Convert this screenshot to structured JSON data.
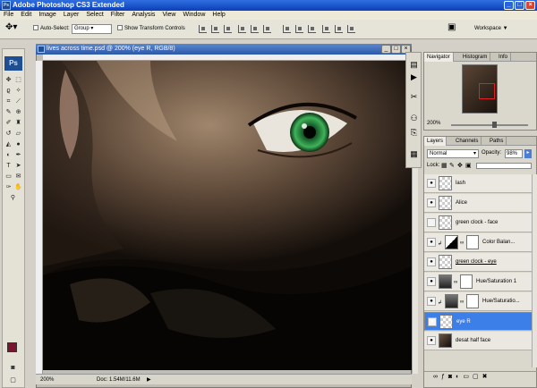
{
  "app": {
    "title": "Adobe Photoshop CS3 Extended"
  },
  "menu": [
    "File",
    "Edit",
    "Image",
    "Layer",
    "Select",
    "Filter",
    "Analysis",
    "View",
    "Window",
    "Help"
  ],
  "options": {
    "auto_select_label": "Auto-Select:",
    "auto_select_value": "Group",
    "show_transform_label": "Show Transform Controls",
    "workspace_label": "Workspace ▼"
  },
  "toolbox": {
    "logo": "Ps"
  },
  "document": {
    "title": "lives across time.psd @ 200% (eye R, RGB/8)",
    "zoom": "200%",
    "doc_size": "Doc: 1.54M/11.6M"
  },
  "navigator": {
    "tabs": [
      "Navigator",
      "Histogram",
      "Info"
    ],
    "zoom": "200%"
  },
  "layers": {
    "tabs": [
      "Layers",
      "Channels",
      "Paths"
    ],
    "blend_mode": "Normal",
    "opacity_label": "Opacity:",
    "opacity_value": "98%",
    "lock_label": "Lock:",
    "items": [
      {
        "name": "lash"
      },
      {
        "name": "Alice"
      },
      {
        "name": "green clock - face"
      },
      {
        "name": "Color Balan..."
      },
      {
        "name": "green clock - eye"
      },
      {
        "name": "Hue/Saturation 1"
      },
      {
        "name": "Hue/Saturatio..."
      },
      {
        "name": "eye R"
      },
      {
        "name": "desat half face"
      }
    ]
  },
  "colors": {
    "foreground": "#7a1530",
    "background": "#ffffff",
    "selection": "#3c7fe8"
  }
}
